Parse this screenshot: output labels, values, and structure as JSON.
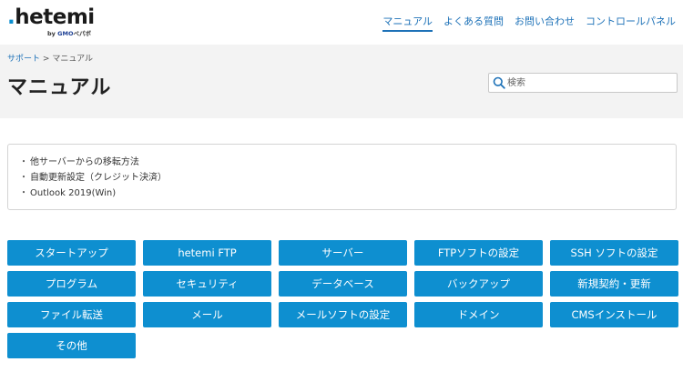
{
  "brand": {
    "logo_text": "hetemi",
    "logo_sub_prefix": "by",
    "logo_sub_gmo": "GMO",
    "logo_sub_company": "ペパボ"
  },
  "nav": [
    {
      "label": "マニュアル",
      "active": true
    },
    {
      "label": "よくある質問",
      "active": false
    },
    {
      "label": "お問い合わせ",
      "active": false
    },
    {
      "label": "コントロールパネル",
      "active": false
    }
  ],
  "breadcrumb": {
    "parent": "サポート",
    "separator": ">",
    "current": "マニュアル"
  },
  "page_title": "マニュアル",
  "search": {
    "placeholder": "検索",
    "icon": "search-icon"
  },
  "links": {
    "bullet": "・",
    "items": [
      "他サーバーからの移転方法",
      "自動更新設定（クレジット決済）",
      "Outlook 2019(Win)"
    ]
  },
  "categories": [
    "スタートアップ",
    "hetemi FTP",
    "サーバー",
    "FTPソフトの設定",
    "SSH ソフトの設定",
    "プログラム",
    "セキュリティ",
    "データベース",
    "バックアップ",
    "新規契約・更新",
    "ファイル転送",
    "メール",
    "メールソフトの設定",
    "ドメイン",
    "CMSインストール",
    "その他"
  ],
  "colors": {
    "accent": "#0e8fd0",
    "link": "#1e72b8",
    "band": "#f3f3f3"
  }
}
